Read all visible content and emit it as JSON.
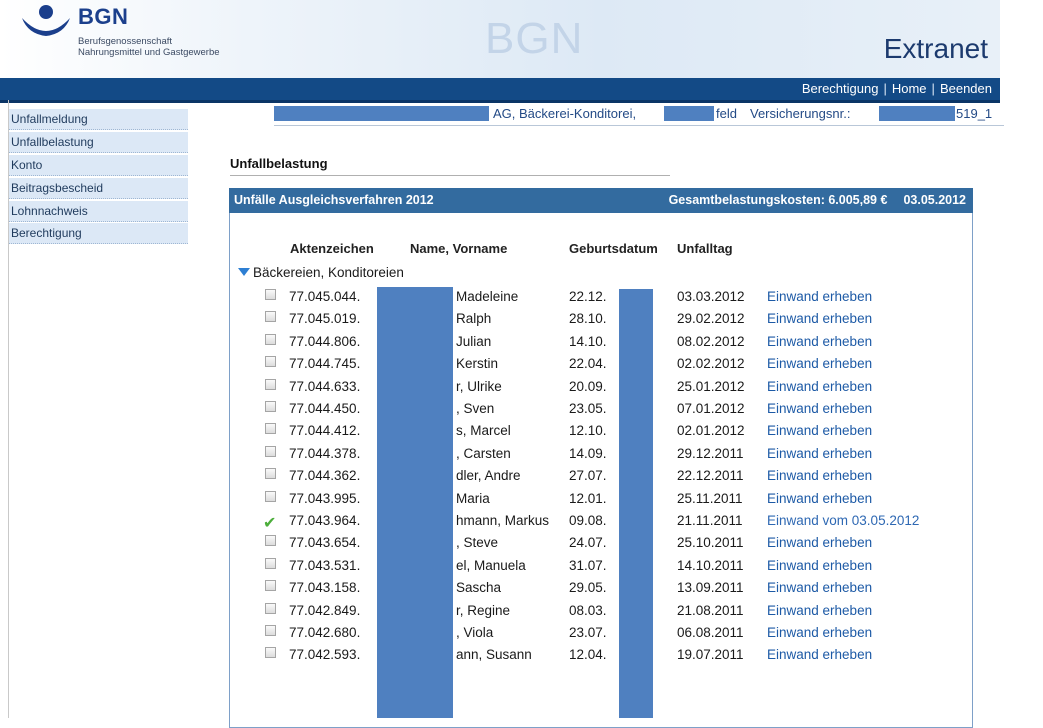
{
  "header": {
    "logo_text": "BGN",
    "logo_sub_line1": "Berufsgenossenschaft",
    "logo_sub_line2": "Nahrungsmittel und Gastgewerbe",
    "watermark": "BGN",
    "brand_title": "Extranet",
    "colors": {
      "brand_blue": "#1b3f8c",
      "bar": "#134a86"
    }
  },
  "topnav": {
    "items": [
      "Berechtigung",
      "Home",
      "Beenden"
    ],
    "separator": "|"
  },
  "sidebar": {
    "items": [
      {
        "label": "Unfallmeldung"
      },
      {
        "label": "Unfallbelastung"
      },
      {
        "label": "Konto"
      },
      {
        "label": "Beitragsbescheid"
      },
      {
        "label": "Lohnnachweis"
      },
      {
        "label": "Berechtigung"
      }
    ]
  },
  "info": {
    "company_suffix": "AG, Bäckerei-Konditorei,",
    "location_suffix": "feld",
    "insurance_label": "Versicherungsnr.:",
    "insurance_suffix": "519_1"
  },
  "page": {
    "title": "Unfallbelastung"
  },
  "panel": {
    "title": "Unfälle Ausgleichsverfahren 2012",
    "total_label": "Gesamtbelastungskosten: 6.005,89 €",
    "date": "03.05.2012"
  },
  "table": {
    "headers": {
      "aktenzeichen": "Aktenzeichen",
      "name": "Name, Vorname",
      "geburtsdatum": "Geburtsdatum",
      "unfalltag": "Unfalltag"
    },
    "group": "Bäckereien, Konditoreien",
    "rows": [
      {
        "az": "77.045.044.",
        "name": "Madeleine",
        "geb": "22.12.",
        "tag": "03.03.2012",
        "action": "Einwand erheben",
        "status": "checkbox"
      },
      {
        "az": "77.045.019.",
        "name": "Ralph",
        "geb": "28.10.",
        "tag": "29.02.2012",
        "action": "Einwand erheben",
        "status": "checkbox"
      },
      {
        "az": "77.044.806.",
        "name": "Julian",
        "geb": "14.10.",
        "tag": "08.02.2012",
        "action": "Einwand erheben",
        "status": "checkbox"
      },
      {
        "az": "77.044.745.",
        "name": "Kerstin",
        "geb": "22.04.",
        "tag": "02.02.2012",
        "action": "Einwand erheben",
        "status": "checkbox"
      },
      {
        "az": "77.044.633.",
        "name": "r, Ulrike",
        "geb": "20.09.",
        "tag": "25.01.2012",
        "action": "Einwand erheben",
        "status": "checkbox"
      },
      {
        "az": "77.044.450.",
        "name": ", Sven",
        "geb": "23.05.",
        "tag": "07.01.2012",
        "action": "Einwand erheben",
        "status": "checkbox"
      },
      {
        "az": "77.044.412.",
        "name": "s, Marcel",
        "geb": "12.10.",
        "tag": "02.01.2012",
        "action": "Einwand erheben",
        "status": "checkbox"
      },
      {
        "az": "77.044.378.",
        "name": ", Carsten",
        "geb": "14.09.",
        "tag": "29.12.2011",
        "action": "Einwand erheben",
        "status": "checkbox"
      },
      {
        "az": "77.044.362.",
        "name": "dler, Andre",
        "geb": "27.07.",
        "tag": "22.12.2011",
        "action": "Einwand erheben",
        "status": "checkbox"
      },
      {
        "az": "77.043.995.",
        "name": "Maria",
        "geb": "12.01.",
        "tag": "25.11.2011",
        "action": "Einwand erheben",
        "status": "checkbox"
      },
      {
        "az": "77.043.964.",
        "name": "hmann, Markus",
        "geb": "09.08.",
        "tag": "21.11.2011",
        "action": "Einwand vom 03.05.2012",
        "status": "checked"
      },
      {
        "az": "77.043.654.",
        "name": ", Steve",
        "geb": "24.07.",
        "tag": "25.10.2011",
        "action": "Einwand erheben",
        "status": "checkbox"
      },
      {
        "az": "77.043.531.",
        "name": "el, Manuela",
        "geb": "31.07.",
        "tag": "14.10.2011",
        "action": "Einwand erheben",
        "status": "checkbox"
      },
      {
        "az": "77.043.158.",
        "name": "Sascha",
        "geb": "29.05.",
        "tag": "13.09.2011",
        "action": "Einwand erheben",
        "status": "checkbox"
      },
      {
        "az": "77.042.849.",
        "name": "r, Regine",
        "geb": "08.03.",
        "tag": "21.08.2011",
        "action": "Einwand erheben",
        "status": "checkbox"
      },
      {
        "az": "77.042.680.",
        "name": ", Viola",
        "geb": "23.07.",
        "tag": "06.08.2011",
        "action": "Einwand erheben",
        "status": "checkbox"
      },
      {
        "az": "77.042.593.",
        "name": "ann, Susann",
        "geb": "12.04.",
        "tag": "19.07.2011",
        "action": "Einwand erheben",
        "status": "checkbox"
      }
    ]
  }
}
